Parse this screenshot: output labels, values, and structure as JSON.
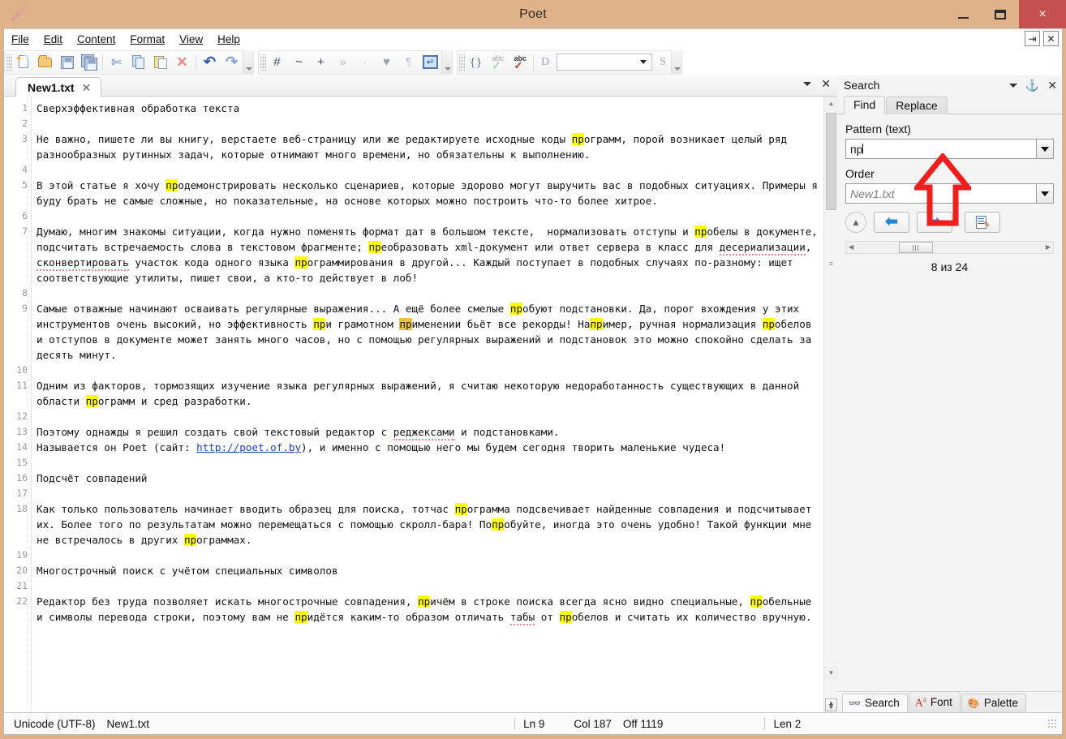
{
  "window": {
    "title": "Poet",
    "app_icon": "quill-icon",
    "minimize_label": "Minimize",
    "maximize_label": "Maximize",
    "close_label": "×"
  },
  "menubar": {
    "items": [
      {
        "label": "File",
        "accel": "F"
      },
      {
        "label": "Edit",
        "accel": "E"
      },
      {
        "label": "Content",
        "accel": "C"
      },
      {
        "label": "Format",
        "accel": "o"
      },
      {
        "label": "View",
        "accel": "V"
      },
      {
        "label": "Help",
        "accel": "H"
      }
    ],
    "right_buttons": [
      "⇥",
      "✕"
    ]
  },
  "toolbar": {
    "groups": [
      {
        "name": "file-edit",
        "buttons": [
          {
            "name": "new-file-icon",
            "glyph": "new"
          },
          {
            "name": "open-folder-icon",
            "glyph": "open"
          },
          {
            "name": "save-icon",
            "glyph": "save"
          },
          {
            "name": "save-all-icon",
            "glyph": "saveall"
          },
          {
            "name": "cut-icon",
            "glyph": "✂"
          },
          {
            "name": "copy-icon",
            "glyph": "copy"
          },
          {
            "name": "paste-icon",
            "glyph": "paste"
          },
          {
            "name": "delete-icon",
            "glyph": "✕"
          },
          {
            "name": "undo-icon",
            "glyph": "↶"
          },
          {
            "name": "redo-icon",
            "glyph": "↷"
          }
        ]
      },
      {
        "name": "symbols",
        "buttons": [
          {
            "name": "hash-icon",
            "glyph": "#"
          },
          {
            "name": "tilde-icon",
            "glyph": "~"
          },
          {
            "name": "plus-icon",
            "glyph": "+"
          },
          {
            "name": "double-angle-icon",
            "glyph": "»"
          },
          {
            "name": "dot-icon",
            "glyph": "·"
          },
          {
            "name": "heart-icon",
            "glyph": "♥"
          },
          {
            "name": "pilcrow-icon",
            "glyph": "¶"
          },
          {
            "name": "enter-icon",
            "glyph": "↵"
          }
        ]
      },
      {
        "name": "spelling",
        "buttons": [
          {
            "name": "braces-icon",
            "glyph": "{ }"
          },
          {
            "name": "spellcheck-ok-icon",
            "glyph": "abc"
          },
          {
            "name": "spellcheck-error-icon",
            "glyph": "abc"
          }
        ]
      }
    ],
    "dict_label": "D",
    "dict_value": "",
    "style_label": "S"
  },
  "editor": {
    "tab": {
      "label": "New1.txt",
      "close": "✕"
    },
    "strip_controls": {
      "menu": "▾",
      "close": "✕"
    },
    "line_numbers": [
      "1",
      "2",
      "3",
      "",
      "",
      "4",
      "5",
      "",
      "",
      "6",
      "7",
      "",
      "",
      "",
      "",
      "8",
      "9",
      "",
      "",
      "",
      "10",
      "11",
      "",
      "12",
      "13",
      "14",
      "",
      "15",
      "16",
      "17",
      "18",
      "",
      "",
      "19",
      "20",
      "21",
      "22",
      "",
      ""
    ],
    "lines": [
      {
        "n": 1,
        "parts": [
          {
            "t": "Сверхэффективная обработка текста"
          }
        ]
      },
      {
        "n": 2,
        "parts": [
          {
            "t": ""
          }
        ]
      },
      {
        "n": 3,
        "parts": [
          {
            "t": "Не важно, пишете ли вы книгу, верстаете веб-страницу или же редактируете исходные коды "
          },
          {
            "t": "пр",
            "hl": "match"
          },
          {
            "t": "ограмм, порой возникает целый ряд разнообразных рутинных задач, которые отнимают много времени, но обязательны к выполнению."
          }
        ]
      },
      {
        "n": 4,
        "parts": [
          {
            "t": ""
          }
        ]
      },
      {
        "n": 5,
        "parts": [
          {
            "t": "В этой статье я хочу "
          },
          {
            "t": "пр",
            "hl": "match"
          },
          {
            "t": "одемонстрировать несколько сценариев, которые здорово могут выручить вас в подобных ситуациях. Примеры я буду брать не самые сложные, но показательные, на основе которых можно построить что-то более хитрое."
          }
        ]
      },
      {
        "n": 6,
        "parts": [
          {
            "t": ""
          }
        ]
      },
      {
        "n": 7,
        "parts": [
          {
            "t": "Думаю, многим знакомы ситуации, когда нужно поменять формат дат в большом тексте,  нормализовать отступы и "
          },
          {
            "t": "пр",
            "hl": "match"
          },
          {
            "t": "обелы в документе, подсчитать встречаемость слова в текстовом фрагменте; "
          },
          {
            "t": "пр",
            "hl": "match"
          },
          {
            "t": "еобразовать xml-документ или ответ сервера в класс для "
          },
          {
            "t": "десериализации",
            "sp": true
          },
          {
            "t": ", "
          },
          {
            "t": "сконвертировать",
            "sp": true
          },
          {
            "t": " участок кода одного языка "
          },
          {
            "t": "пр",
            "hl": "match"
          },
          {
            "t": "ограммирования в другой... Каждый поступает в подобных случаях по-разному: ищет соответствующие утилиты, пишет свои, а кто-то действует в лоб!"
          }
        ]
      },
      {
        "n": 8,
        "parts": [
          {
            "t": ""
          }
        ]
      },
      {
        "n": 9,
        "parts": [
          {
            "t": "Самые отважные начинают осваивать регулярные выражения... А ещё более смелые "
          },
          {
            "t": "пр",
            "hl": "match"
          },
          {
            "t": "обуют подстановки. Да, порог вхождения у этих инструментов очень высокий, но эффективность "
          },
          {
            "t": "пр",
            "hl": "match"
          },
          {
            "t": "и грамотном "
          },
          {
            "t": "пр",
            "hl": "current"
          },
          {
            "t": "именении бьёт все рекорды! На"
          },
          {
            "t": "пр",
            "hl": "match"
          },
          {
            "t": "имер, ручная нормализация "
          },
          {
            "t": "пр",
            "hl": "match"
          },
          {
            "t": "обелов и отступов в документе может занять много часов, но с помощью регулярных выражений и подстановок это можно спокойно сделать за десять минут."
          }
        ]
      },
      {
        "n": 10,
        "parts": [
          {
            "t": ""
          }
        ]
      },
      {
        "n": 11,
        "parts": [
          {
            "t": "Одним из факторов, тормозящих изучение языка регулярных выражений, я считаю некоторую недоработанность существующих в данной области "
          },
          {
            "t": "пр",
            "hl": "match"
          },
          {
            "t": "ограмм и сред разработки."
          }
        ]
      },
      {
        "n": 12,
        "parts": [
          {
            "t": ""
          }
        ]
      },
      {
        "n": 13,
        "parts": [
          {
            "t": "Поэтому однажды я решил создать свой текстовый редактор с "
          },
          {
            "t": "реджексами",
            "sp": true
          },
          {
            "t": " и подстановками."
          }
        ]
      },
      {
        "n": 14,
        "parts": [
          {
            "t": "Называется он Poet (сайт: "
          },
          {
            "t": "http://poet.of.by",
            "link": true
          },
          {
            "t": "), и именно с помощью него мы будем сегодня творить маленькие чудеса!"
          }
        ]
      },
      {
        "n": 15,
        "parts": [
          {
            "t": ""
          }
        ]
      },
      {
        "n": 16,
        "parts": [
          {
            "t": "Подсчёт совпадений"
          }
        ]
      },
      {
        "n": 17,
        "parts": [
          {
            "t": ""
          }
        ]
      },
      {
        "n": 18,
        "parts": [
          {
            "t": "Как только пользователь начинает вводить образец для поиска, тотчас "
          },
          {
            "t": "пр",
            "hl": "match"
          },
          {
            "t": "ограмма подсвечивает найденные совпадения и подсчитывает их. Более того по результатам можно перемещаться с помощью скролл-бара! По"
          },
          {
            "t": "пр",
            "hl": "match"
          },
          {
            "t": "обуйте, иногда это очень удобно! Такой функции мне не встречалось в других "
          },
          {
            "t": "пр",
            "hl": "match"
          },
          {
            "t": "ограммах."
          }
        ]
      },
      {
        "n": 19,
        "parts": [
          {
            "t": ""
          }
        ]
      },
      {
        "n": 20,
        "parts": [
          {
            "t": "Многострочный поиск с учётом специальных символов"
          }
        ]
      },
      {
        "n": 21,
        "parts": [
          {
            "t": ""
          }
        ]
      },
      {
        "n": 22,
        "parts": [
          {
            "t": "Редактор без труда позволяет искать многострочные совпадения, "
          },
          {
            "t": "пр",
            "hl": "match"
          },
          {
            "t": "ичём в строке поиска всегда ясно видно специальные, "
          },
          {
            "t": "пр",
            "hl": "match"
          },
          {
            "t": "обельные и символы перевода строки, поэтому вам не "
          },
          {
            "t": "пр",
            "hl": "match"
          },
          {
            "t": "идётся каким-то образом отличать "
          },
          {
            "t": "табы",
            "sp": true
          },
          {
            "t": " от "
          },
          {
            "t": "пр",
            "hl": "match"
          },
          {
            "t": "обелов и считать их количество вручную."
          }
        ]
      }
    ]
  },
  "search_panel": {
    "title": "Search",
    "header_controls": {
      "menu": "▾",
      "pin": "⚔",
      "close": "✕"
    },
    "tabs": [
      {
        "label": "Find",
        "active": true
      },
      {
        "label": "Replace",
        "active": false
      }
    ],
    "pattern_label": "Pattern (text)",
    "pattern_value": "пр",
    "order_label": "Order",
    "order_value": "New1.txt",
    "buttons": {
      "toggle": "collapse-button",
      "prev": "find-previous-button",
      "next": "find-next-button",
      "list": "list-results-button"
    },
    "match_count": "8 из 24",
    "scroll_marker": "|||",
    "bottom_tabs": [
      {
        "label": "Search",
        "icon": "binoculars-icon",
        "active": true
      },
      {
        "label": "Font",
        "icon": "font-icon",
        "active": false
      },
      {
        "label": "Palette",
        "icon": "palette-icon",
        "active": false
      }
    ],
    "annotation_arrow": "red-up-arrow"
  },
  "statusbar": {
    "encoding": "Unicode (UTF-8)",
    "filename": "New1.txt",
    "line": "Ln 9",
    "col": "Col 187",
    "offset": "Off 1119",
    "length": "Len 2"
  },
  "colors": {
    "frame": "#e0b289",
    "close_button": "#c4504f",
    "match_highlight": "#ffff00",
    "current_match_highlight": "#e8c341",
    "link": "#1a3fc4",
    "spellcheck_underline": "#e98b8b",
    "arrow_blue": "#1f8ad6",
    "annotation_red": "#f01e1e"
  }
}
